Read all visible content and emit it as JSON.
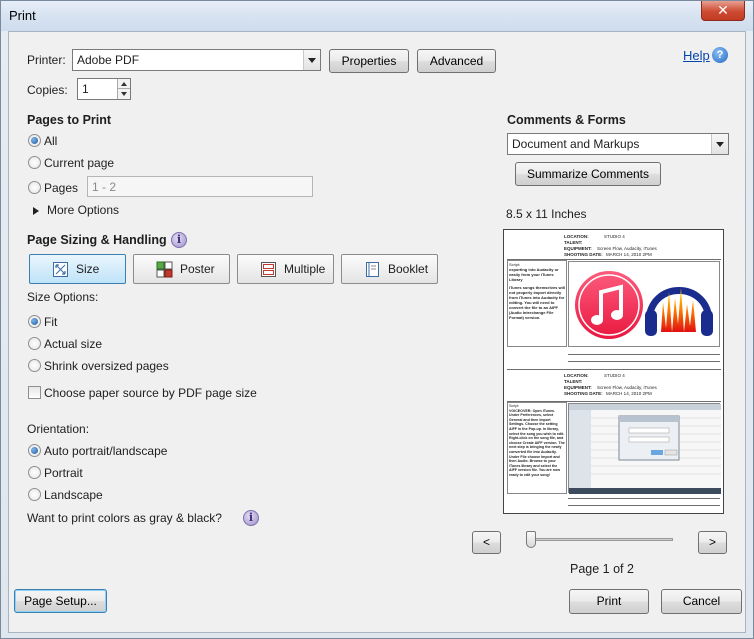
{
  "window": {
    "title": "Print",
    "close_glyph": "✕"
  },
  "help": {
    "label": "Help",
    "icon": "help-icon"
  },
  "printer": {
    "label": "Printer:",
    "selected": "Adobe PDF",
    "properties_label": "Properties",
    "advanced_label": "Advanced"
  },
  "copies": {
    "label": "Copies:",
    "value": "1"
  },
  "pages_to_print": {
    "heading": "Pages to Print",
    "all_label": "All",
    "current_label": "Current page",
    "pages_label": "Pages",
    "pages_value": "1 - 2",
    "more_options_label": "More Options",
    "selected": "All"
  },
  "sizing": {
    "heading": "Page Sizing & Handling",
    "info_glyph": "i",
    "tabs": [
      {
        "label": "Size",
        "icon": "size-icon",
        "selected": true
      },
      {
        "label": "Poster",
        "icon": "poster-icon",
        "selected": false
      },
      {
        "label": "Multiple",
        "icon": "multiple-icon",
        "selected": false
      },
      {
        "label": "Booklet",
        "icon": "booklet-icon",
        "selected": false
      }
    ],
    "size_options_label": "Size Options:",
    "fit_label": "Fit",
    "actual_label": "Actual size",
    "shrink_label": "Shrink oversized pages",
    "choose_paper_label": "Choose paper source by PDF page size",
    "selected_option": "Fit"
  },
  "orientation": {
    "heading": "Orientation:",
    "auto_label": "Auto portrait/landscape",
    "portrait_label": "Portrait",
    "landscape_label": "Landscape",
    "selected": "Auto portrait/landscape"
  },
  "gray_question": "Want to print colors as gray & black?",
  "comments_forms": {
    "heading": "Comments & Forms",
    "selected": "Document and Markups",
    "summarize_label": "Summarize Comments"
  },
  "preview": {
    "paper_size": "8.5 x 11 Inches",
    "prev_glyph": "<",
    "next_glyph": ">",
    "page_indicator": "Page 1 of 2",
    "slider_position": 0,
    "sheet1": {
      "location_label": "LOCATION:",
      "location_value": "STUDIO 4",
      "talent_label": "TALENT:",
      "equipment_label": "EQUIPMENT:",
      "equipment_value": "Screen Flow, Audacity, iTunes",
      "shooting_label": "SHOOTING DATE:",
      "shooting_value": "MARCH 14, 2010 2PM",
      "script_label": "Script:",
      "script_text": "exporting into Audacity or easily from your iTunes Library",
      "script_text2": "iTunes songs themselves will not properly import directly from iTunes into Audacity for editing. You will need to convert the file to an AIFF (Audio Interchange File Format) version."
    },
    "sheet2": {
      "location_label": "LOCATION:",
      "location_value": "STUDIO 4",
      "talent_label": "TALENT:",
      "equipment_label": "EQUIPMENT:",
      "equipment_value": "Screen Flow, Audacity, iTunes",
      "shooting_label": "SHOOTING DATE:",
      "shooting_value": "MARCH 14, 2010 2PM",
      "script_label": "Script:",
      "script_text": "VOICEOVER: Open iTunes. Under Preferences, select General and then Import Settings. Choose the setting AIFF in the Pop-up. In library, select the song you wish to edit. Right-click on the song file, and choose Create AIFF version. The next step is bringing the newly converted file into Audacity. Under File choose Import and then Audio. Browse to your iTunes library and select the AIFF version file. You are now ready to edit your song!"
    }
  },
  "footer": {
    "page_setup_label": "Page Setup...",
    "print_label": "Print",
    "cancel_label": "Cancel"
  },
  "colors": {
    "accent": "#3c7fb1",
    "link": "#0645ad",
    "close_button": "#c23b22"
  }
}
